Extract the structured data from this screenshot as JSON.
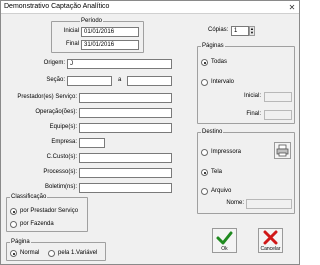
{
  "window": {
    "title": "Demonstrativo Captação Analítico",
    "close_glyph": "✕"
  },
  "periodo": {
    "legend": "Período",
    "inicial_label": "Inicial",
    "inicial_value": "01/01/2016",
    "final_label": "Final",
    "final_value": "31/01/2016"
  },
  "filters": {
    "origem_label": "Origem:",
    "origem_value": "J",
    "secao_label": "Seção:",
    "secao_sep": "a",
    "prestador_label": "Prestador(es) Serviço:",
    "operacao_label": "Operação(ões):",
    "equipe_label": "Equipe(s):",
    "empresa_label": "Empresa:",
    "ccusto_label": "C.Custo(s):",
    "processo_label": "Processo(s):",
    "boletim_label": "Boletim(ns):"
  },
  "classificacao": {
    "legend": "Classificação",
    "options": [
      "por Prestador Serviço",
      "por Fazenda"
    ],
    "selected": 0
  },
  "pagina": {
    "legend": "Página",
    "options": [
      "Normal",
      "pela 1.Variável"
    ],
    "selected": 0
  },
  "copias": {
    "label": "Cópias:",
    "value": "1"
  },
  "paginas": {
    "legend": "Páginas",
    "todas": "Todas",
    "intervalo": "Intervalo",
    "inicial_label": "Inicial:",
    "final_label": "Final:"
  },
  "destino": {
    "legend": "Destino",
    "impressora": "Impressora",
    "tela": "Tela",
    "arquivo": "Arquivo",
    "nome_label": "Nome:"
  },
  "buttons": {
    "ok_label": "Ok",
    "cancel_label": "Cancelar"
  },
  "colors": {
    "ok_check": "#1f8a1f",
    "cancel_x": "#d01818"
  }
}
